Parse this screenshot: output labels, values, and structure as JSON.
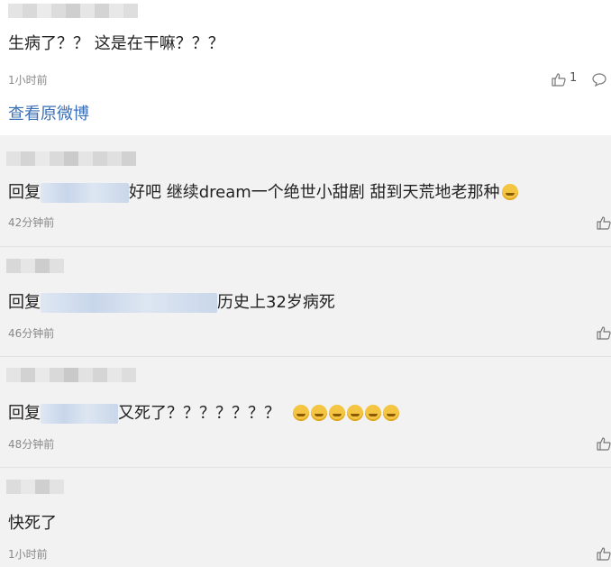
{
  "main_post": {
    "text": "生病了？？ 这是在干嘛？？？",
    "time": "1小时前",
    "like_count": "1",
    "view_original": "查看原微博"
  },
  "replies": [
    {
      "prefix": "回复",
      "suffix": "好吧 继续dream一个绝世小甜剧 甜到天荒地老那种",
      "time": "42分钟前"
    },
    {
      "prefix": "回复",
      "suffix": "历史上32岁病死",
      "time": "46分钟前"
    },
    {
      "prefix": "回复",
      "suffix": "又死了？？？？？？？",
      "time": "48分钟前",
      "emoji_count": 6
    },
    {
      "text": "快死了",
      "time": "1小时前"
    }
  ],
  "icons": {
    "like": "thumbs-up-icon",
    "comment": "comment-bubble-icon",
    "emoji_laugh": "grin-emoji-icon",
    "emoji_sweat": "sweat-smile-emoji-icon"
  },
  "colors": {
    "link": "#3b6fb6",
    "time": "#888888",
    "reply_bg": "#f2f2f2"
  }
}
